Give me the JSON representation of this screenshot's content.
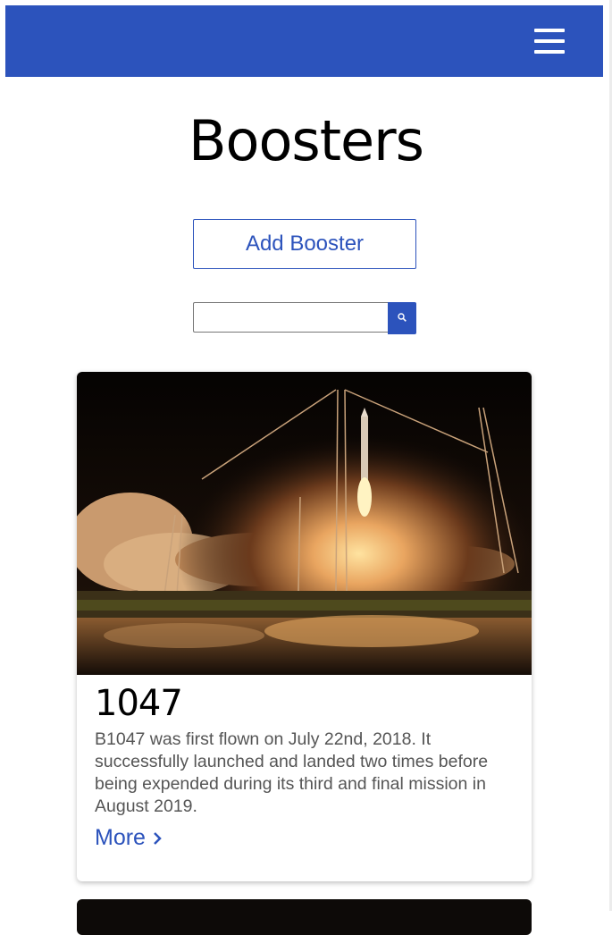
{
  "header": {
    "menu_icon": "hamburger-menu-icon",
    "brand_color": "#2c53bc"
  },
  "page": {
    "title": "Boosters",
    "add_button_label": "Add Booster"
  },
  "search": {
    "placeholder": "",
    "value": "",
    "button_icon": "search-icon"
  },
  "cards": [
    {
      "image": "rocket-launch-night-photo",
      "title": "1047",
      "description": "B1047 was first flown on July 22nd, 2018. It successfully launched and landed two times before being expended during its third and final mission in August 2019.",
      "more_label": "More",
      "more_icon": "chevron-right-icon"
    }
  ]
}
